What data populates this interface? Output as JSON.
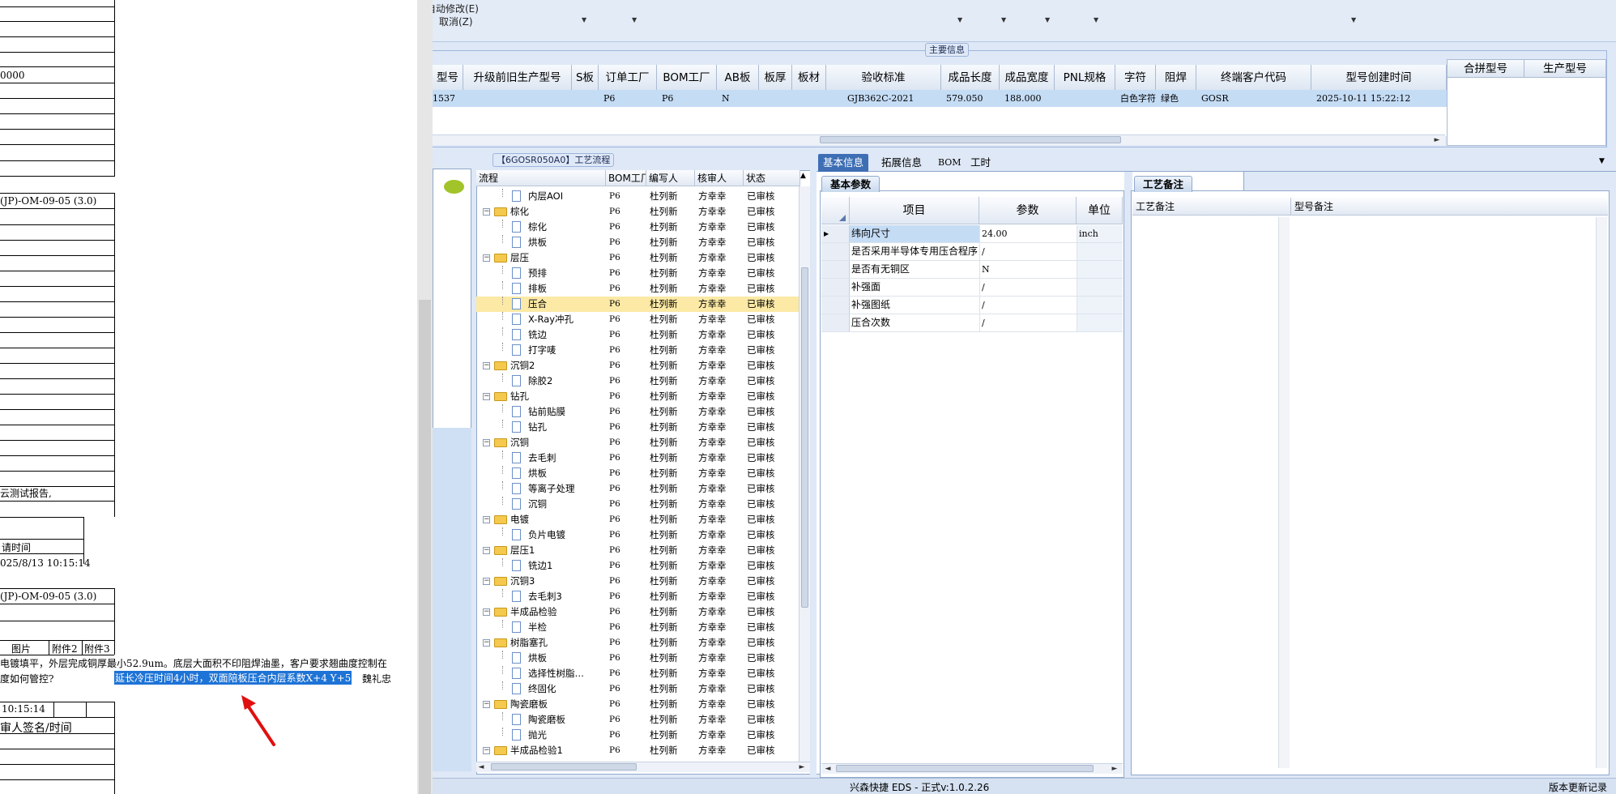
{
  "left_document": {
    "fragments": {
      "amount": "0000",
      "code1": "(JP)-OM-09-05 (3.0)",
      "report": "云测试报告,",
      "apply_time_label": "请时间",
      "apply_time_value": "025/8/13 10:15:14",
      "code2": "(JP)-OM-09-05 (3.0)",
      "col_picture": "图片",
      "col_attach2": "附件2",
      "col_attach3": "附件3",
      "question_line1": "电镀填平，外层完成铜厚最小52.9um。底层大面积不印阻焊油墨，客户要求翘曲度控制在",
      "question_line2": "度如何管控?",
      "answer_highlight": "延长冷压时间4小时，双面陪板压合内层系数X+4 Y+5",
      "answer_name": "魏礼忠",
      "time3": "10:15:14",
      "signer": "审人签名/时间"
    }
  },
  "app": {
    "menu_top": "自动修改(E)",
    "menu_cancel": "取消(Z)",
    "main_group_title": "主要信息",
    "main_grid": {
      "headers": [
        "型号",
        "升级前旧生产型号",
        "S板",
        "订单工厂",
        "BOM工厂",
        "AB板",
        "板厚",
        "板材",
        "验收标准",
        "成品长度",
        "成品宽度",
        "PNL规格",
        "字符",
        "阻焊",
        "终端客户代码",
        "型号创建时间"
      ],
      "row": [
        "1537",
        "",
        "",
        "P6",
        "P6",
        "N",
        "",
        "",
        "GJB362C-2021",
        "579.050",
        "188.000",
        "",
        "白色字符",
        "绿色",
        "GOSR",
        "2025-10-11 15:22:12"
      ]
    },
    "side_grid_headers": [
      "合拼型号",
      "生产型号"
    ],
    "process_group_title": "【6GOSR050A0】工艺流程",
    "tree_headers": [
      "流程",
      "BOM工厂",
      "编写人",
      "核审人",
      "状态"
    ],
    "tree_rows": [
      {
        "level": 1,
        "type": "doc",
        "name": "内层AOI",
        "bom": "P6",
        "writer": "杜列新",
        "reviewer": "方幸幸",
        "status": "已审核"
      },
      {
        "level": 0,
        "type": "folder",
        "name": "棕化",
        "bom": "P6",
        "writer": "杜列新",
        "reviewer": "方幸幸",
        "status": "已审核"
      },
      {
        "level": 1,
        "type": "doc",
        "name": "棕化",
        "bom": "P6",
        "writer": "杜列新",
        "reviewer": "方幸幸",
        "status": "已审核"
      },
      {
        "level": 1,
        "type": "doc",
        "name": "烘板",
        "bom": "P6",
        "writer": "杜列新",
        "reviewer": "方幸幸",
        "status": "已审核"
      },
      {
        "level": 0,
        "type": "folder",
        "name": "层压",
        "bom": "P6",
        "writer": "杜列新",
        "reviewer": "方幸幸",
        "status": "已审核"
      },
      {
        "level": 1,
        "type": "doc",
        "name": "预排",
        "bom": "P6",
        "writer": "杜列新",
        "reviewer": "方幸幸",
        "status": "已审核"
      },
      {
        "level": 1,
        "type": "doc",
        "name": "排板",
        "bom": "P6",
        "writer": "杜列新",
        "reviewer": "方幸幸",
        "status": "已审核"
      },
      {
        "level": 1,
        "type": "doc",
        "name": "压合",
        "bom": "P6",
        "writer": "杜列新",
        "reviewer": "方幸幸",
        "status": "已审核",
        "selected": true
      },
      {
        "level": 1,
        "type": "doc",
        "name": "X-Ray冲孔",
        "bom": "P6",
        "writer": "杜列新",
        "reviewer": "方幸幸",
        "status": "已审核"
      },
      {
        "level": 1,
        "type": "doc",
        "name": "铣边",
        "bom": "P6",
        "writer": "杜列新",
        "reviewer": "方幸幸",
        "status": "已审核"
      },
      {
        "level": 1,
        "type": "doc",
        "name": "打字唛",
        "bom": "P6",
        "writer": "杜列新",
        "reviewer": "方幸幸",
        "status": "已审核"
      },
      {
        "level": 0,
        "type": "folder",
        "name": "沉铜2",
        "bom": "P6",
        "writer": "杜列新",
        "reviewer": "方幸幸",
        "status": "已审核"
      },
      {
        "level": 1,
        "type": "doc",
        "name": "除胶2",
        "bom": "P6",
        "writer": "杜列新",
        "reviewer": "方幸幸",
        "status": "已审核"
      },
      {
        "level": 0,
        "type": "folder",
        "name": "钻孔",
        "bom": "P6",
        "writer": "杜列新",
        "reviewer": "方幸幸",
        "status": "已审核"
      },
      {
        "level": 1,
        "type": "doc",
        "name": "钻前贴膜",
        "bom": "P6",
        "writer": "杜列新",
        "reviewer": "方幸幸",
        "status": "已审核"
      },
      {
        "level": 1,
        "type": "doc",
        "name": "钻孔",
        "bom": "P6",
        "writer": "杜列新",
        "reviewer": "方幸幸",
        "status": "已审核"
      },
      {
        "level": 0,
        "type": "folder",
        "name": "沉铜",
        "bom": "P6",
        "writer": "杜列新",
        "reviewer": "方幸幸",
        "status": "已审核"
      },
      {
        "level": 1,
        "type": "doc",
        "name": "去毛刺",
        "bom": "P6",
        "writer": "杜列新",
        "reviewer": "方幸幸",
        "status": "已审核"
      },
      {
        "level": 1,
        "type": "doc",
        "name": "烘板",
        "bom": "P6",
        "writer": "杜列新",
        "reviewer": "方幸幸",
        "status": "已审核"
      },
      {
        "level": 1,
        "type": "doc",
        "name": "等离子处理",
        "bom": "P6",
        "writer": "杜列新",
        "reviewer": "方幸幸",
        "status": "已审核"
      },
      {
        "level": 1,
        "type": "doc",
        "name": "沉铜",
        "bom": "P6",
        "writer": "杜列新",
        "reviewer": "方幸幸",
        "status": "已审核"
      },
      {
        "level": 0,
        "type": "folder",
        "name": "电镀",
        "bom": "P6",
        "writer": "杜列新",
        "reviewer": "方幸幸",
        "status": "已审核"
      },
      {
        "level": 1,
        "type": "doc",
        "name": "负片电镀",
        "bom": "P6",
        "writer": "杜列新",
        "reviewer": "方幸幸",
        "status": "已审核"
      },
      {
        "level": 0,
        "type": "folder",
        "name": "层压1",
        "bom": "P6",
        "writer": "杜列新",
        "reviewer": "方幸幸",
        "status": "已审核"
      },
      {
        "level": 1,
        "type": "doc",
        "name": "铣边1",
        "bom": "P6",
        "writer": "杜列新",
        "reviewer": "方幸幸",
        "status": "已审核"
      },
      {
        "level": 0,
        "type": "folder",
        "name": "沉铜3",
        "bom": "P6",
        "writer": "杜列新",
        "reviewer": "方幸幸",
        "status": "已审核"
      },
      {
        "level": 1,
        "type": "doc",
        "name": "去毛刺3",
        "bom": "P6",
        "writer": "杜列新",
        "reviewer": "方幸幸",
        "status": "已审核"
      },
      {
        "level": 0,
        "type": "folder",
        "name": "半成品检验",
        "bom": "P6",
        "writer": "杜列新",
        "reviewer": "方幸幸",
        "status": "已审核"
      },
      {
        "level": 1,
        "type": "doc",
        "name": "半检",
        "bom": "P6",
        "writer": "杜列新",
        "reviewer": "方幸幸",
        "status": "已审核"
      },
      {
        "level": 0,
        "type": "folder",
        "name": "树脂塞孔",
        "bom": "P6",
        "writer": "杜列新",
        "reviewer": "方幸幸",
        "status": "已审核"
      },
      {
        "level": 1,
        "type": "doc",
        "name": "烘板",
        "bom": "P6",
        "writer": "杜列新",
        "reviewer": "方幸幸",
        "status": "已审核"
      },
      {
        "level": 1,
        "type": "doc",
        "name": "选择性树脂…",
        "bom": "P6",
        "writer": "杜列新",
        "reviewer": "方幸幸",
        "status": "已审核"
      },
      {
        "level": 1,
        "type": "doc",
        "name": "终固化",
        "bom": "P6",
        "writer": "杜列新",
        "reviewer": "方幸幸",
        "status": "已审核"
      },
      {
        "level": 0,
        "type": "folder",
        "name": "陶瓷磨板",
        "bom": "P6",
        "writer": "杜列新",
        "reviewer": "方幸幸",
        "status": "已审核"
      },
      {
        "level": 1,
        "type": "doc",
        "name": "陶瓷磨板",
        "bom": "P6",
        "writer": "杜列新",
        "reviewer": "方幸幸",
        "status": "已审核"
      },
      {
        "level": 1,
        "type": "doc",
        "name": "抛光",
        "bom": "P6",
        "writer": "杜列新",
        "reviewer": "方幸幸",
        "status": "已审核"
      },
      {
        "level": 0,
        "type": "folder",
        "name": "半成品检验1",
        "bom": "P6",
        "writer": "杜列新",
        "reviewer": "方幸幸",
        "status": "已审核"
      }
    ],
    "tabs": [
      "基本信息",
      "拓展信息",
      "BOM",
      "工时"
    ],
    "subtab_params": "基本参数",
    "param_headers": [
      "项目",
      "参数",
      "单位"
    ],
    "params": [
      {
        "item": "纬向尺寸",
        "value": "24.00",
        "unit": "inch"
      },
      {
        "item": "是否采用半导体专用压合程序",
        "value": "/",
        "unit": ""
      },
      {
        "item": "是否有无铜区",
        "value": "N",
        "unit": ""
      },
      {
        "item": "补强面",
        "value": "/",
        "unit": ""
      },
      {
        "item": "补强图纸",
        "value": "/",
        "unit": ""
      },
      {
        "item": "压合次数",
        "value": "/",
        "unit": ""
      }
    ],
    "subtab_notes": "工艺备注",
    "notes_headers": [
      "工艺备注",
      "型号备注"
    ],
    "status_center": "兴森快捷 EDS - 正式v:1.0.2.26",
    "status_right": "版本更新记录"
  },
  "colors": {
    "selected_row": "#fbe9a5",
    "grid_selected": "#c5dcf5",
    "highlight_text_bg": "#1e73d6",
    "arrow": "#e01010",
    "active_tab": "#3e6fb4"
  }
}
